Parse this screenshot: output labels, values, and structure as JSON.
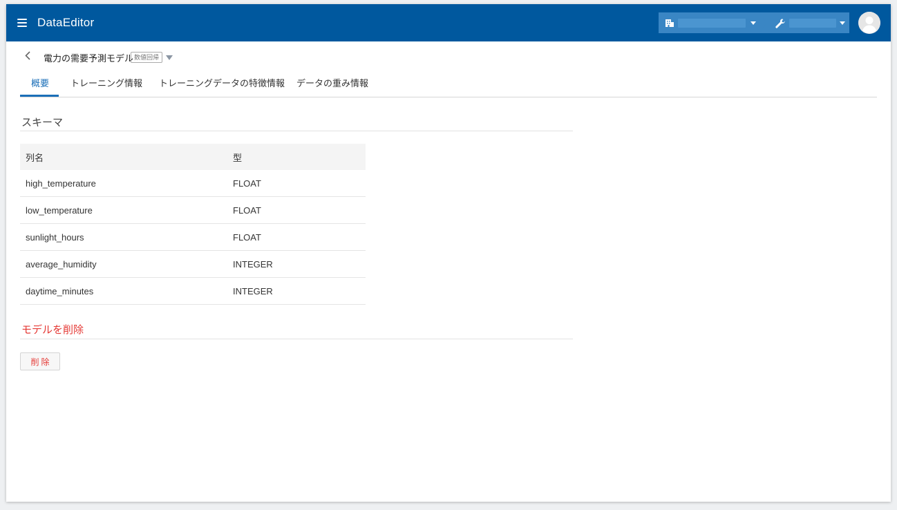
{
  "app": {
    "title": "DataEditor"
  },
  "topbar": {
    "org_icon": "building-icon",
    "project_icon": "wrench-icon",
    "colors": {
      "bar": "#00589e",
      "crumb": "#3a86c4"
    }
  },
  "model": {
    "name": "電力の需要予測モデル",
    "badge": "数値回帰"
  },
  "tabs": [
    {
      "label": "概要",
      "active": true
    },
    {
      "label": "トレーニング情報",
      "active": false
    },
    {
      "label": "トレーニングデータの特徴情報",
      "active": false
    },
    {
      "label": "データの重み情報",
      "active": false
    }
  ],
  "schema": {
    "title": "スキーマ",
    "headers": {
      "name": "列名",
      "type": "型"
    },
    "rows": [
      {
        "name": "high_temperature",
        "type": "FLOAT"
      },
      {
        "name": "low_temperature",
        "type": "FLOAT"
      },
      {
        "name": "sunlight_hours",
        "type": "FLOAT"
      },
      {
        "name": "average_humidity",
        "type": "INTEGER"
      },
      {
        "name": "daytime_minutes",
        "type": "INTEGER"
      }
    ]
  },
  "danger": {
    "title": "モデルを削除",
    "button_label": "削除",
    "color": "#e53935"
  }
}
